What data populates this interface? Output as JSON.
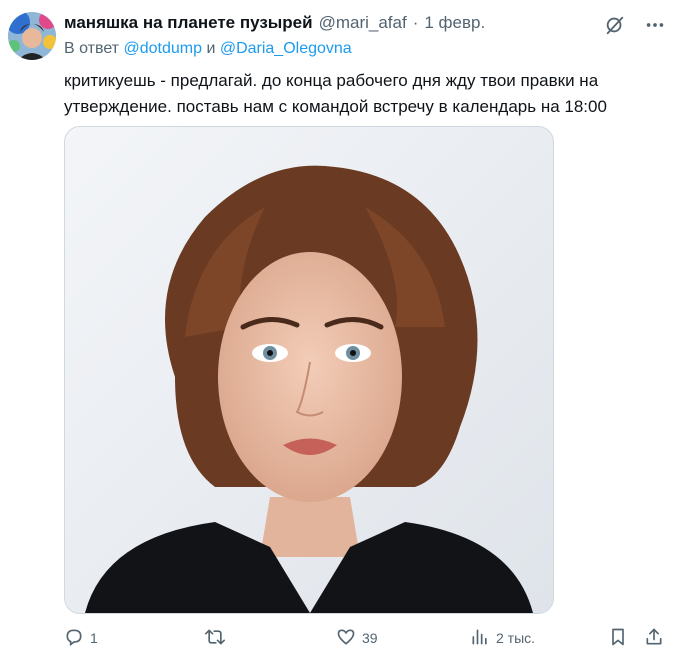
{
  "author": {
    "display_name": "маняшка на планете пузырей",
    "handle": "@mari_afaf",
    "separator": "·",
    "date": "1 февр."
  },
  "reply": {
    "prefix": "В ответ",
    "mention_1": "@dotdump",
    "joiner": "и",
    "mention_2": "@Daria_Olegovna"
  },
  "tweet": {
    "line_1": "критикуешь - предлагай. до конца рабочего дня жду твои правки на",
    "line_2": "утверждение. поставь нам с командой встречу в календарь на 18:00"
  },
  "stats": {
    "replies": "1",
    "retweets": "",
    "likes": "39",
    "views": "2 тыс."
  },
  "icons": {
    "top": [
      "grok-icon",
      "more-icon"
    ],
    "actions": [
      "reply-icon",
      "retweet-icon",
      "like-icon",
      "views-icon",
      "bookmark-icon",
      "share-icon"
    ]
  },
  "colors": {
    "text": "#0f1419",
    "secondary": "#536471",
    "accent": "#1d9bf0"
  }
}
